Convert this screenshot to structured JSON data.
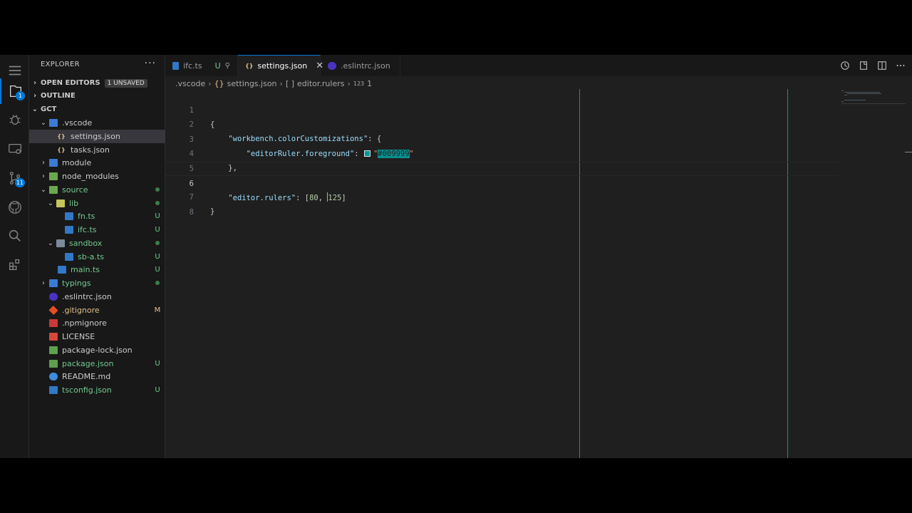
{
  "sidebar": {
    "title": "EXPLORER",
    "more": "···",
    "open_editors": "OPEN EDITORS",
    "unsaved_badge": "1 UNSAVED",
    "outline": "OUTLINE",
    "root": "GCT",
    "tree": [
      {
        "label": ".vscode",
        "status": ""
      },
      {
        "label": "settings.json",
        "status": ""
      },
      {
        "label": "tasks.json",
        "status": ""
      },
      {
        "label": "module",
        "status": ""
      },
      {
        "label": "node_modules",
        "status": ""
      },
      {
        "label": "source",
        "status": ""
      },
      {
        "label": "lib",
        "status": ""
      },
      {
        "label": "fn.ts",
        "status": "U"
      },
      {
        "label": "ifc.ts",
        "status": "U"
      },
      {
        "label": "sandbox",
        "status": ""
      },
      {
        "label": "sb-a.ts",
        "status": "U"
      },
      {
        "label": "main.ts",
        "status": "U"
      },
      {
        "label": "typings",
        "status": ""
      },
      {
        "label": ".eslintrc.json",
        "status": ""
      },
      {
        "label": ".gitignore",
        "status": "M"
      },
      {
        "label": ".npmignore",
        "status": ""
      },
      {
        "label": "LICENSE",
        "status": ""
      },
      {
        "label": "package-lock.json",
        "status": ""
      },
      {
        "label": "package.json",
        "status": "U"
      },
      {
        "label": "README.md",
        "status": ""
      },
      {
        "label": "tsconfig.json",
        "status": "U"
      }
    ]
  },
  "activity": {
    "explorer_badge": "1",
    "scm_badge": "11"
  },
  "tabs": [
    {
      "label": "ifc.ts",
      "status": "U"
    },
    {
      "label": "settings.json",
      "status": ""
    },
    {
      "label": ".eslintrc.json",
      "status": ""
    }
  ],
  "breadcrumb": {
    "folder": ".vscode",
    "file": "settings.json",
    "key": "editor.rulers",
    "index": "1"
  },
  "code": {
    "line_numbers": [
      "1",
      "2",
      "3",
      "4",
      "5",
      "6",
      "7",
      "8"
    ],
    "open_brace": "{",
    "key1": "\"workbench.colorCustomizations\"",
    "colon_brace": ": {",
    "key2": "\"editorRuler.foreground\"",
    "colon": ": ",
    "quote": "\"",
    "color_value": "#009999",
    "close_obj": "},",
    "key3": "\"editor.rulers\"",
    "array_open": ": [",
    "num1": "80",
    "comma": ", ",
    "num2": "125",
    "array_close": "]",
    "close_brace": "}"
  },
  "colors": {
    "accent": "#0078d4",
    "ruler": "#009999",
    "untracked": "#73c991",
    "modified": "#e2c08d"
  }
}
